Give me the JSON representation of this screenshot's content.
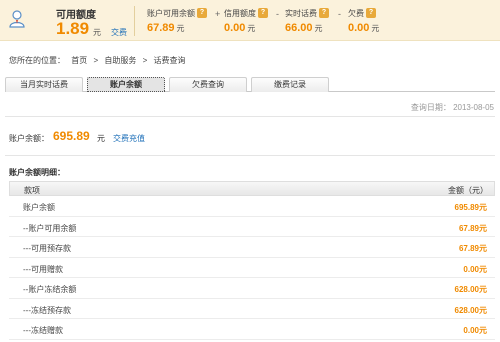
{
  "summary": {
    "credit_title": "可用额度",
    "credit_amount": "1.89",
    "credit_unit": "元",
    "credit_pay_link": "交费",
    "metrics": [
      {
        "label": "账户可用余额",
        "value": "67.89",
        "unit": "元"
      },
      {
        "label": "信用额度",
        "value": "0.00",
        "unit": "元"
      },
      {
        "label": "实时话费",
        "value": "66.00",
        "unit": "元"
      },
      {
        "label": "欠费",
        "value": "0.00",
        "unit": "元"
      }
    ],
    "operators": [
      "+",
      "-",
      "-"
    ],
    "help_glyph": "?"
  },
  "breadcrumb": {
    "prefix": "您所在的位置：",
    "items": [
      "首页",
      ">",
      "自助服务",
      ">",
      "话费查询"
    ]
  },
  "tabs": [
    {
      "label": "当月实时话费",
      "active": false
    },
    {
      "label": "账户余额",
      "active": true
    },
    {
      "label": "欠费查询",
      "active": false
    },
    {
      "label": "缴费记录",
      "active": false
    }
  ],
  "query_date": "查询日期： 2013-08-05",
  "balance": {
    "label": "账户余额：",
    "value": "695.89",
    "unit": "元",
    "link": "交费充值"
  },
  "detail": {
    "title": "账户余额明细：",
    "headers": [
      "款项",
      "金额（元）"
    ],
    "rows": [
      {
        "item": "账户余额",
        "amount": "695.89元"
      },
      {
        "item": "--账户可用余额",
        "amount": "67.89元"
      },
      {
        "item": "---可用预存款",
        "amount": "67.89元"
      },
      {
        "item": "---可用赠款",
        "amount": "0.00元"
      },
      {
        "item": "--账户冻结余额",
        "amount": "628.00元"
      },
      {
        "item": "---冻结预存款",
        "amount": "628.00元"
      },
      {
        "item": "---冻结赠款",
        "amount": "0.00元"
      }
    ]
  },
  "colors": {
    "accent": "#f08a00",
    "link": "#1d6fb8",
    "topbar_bg": "#fbf2dc"
  }
}
